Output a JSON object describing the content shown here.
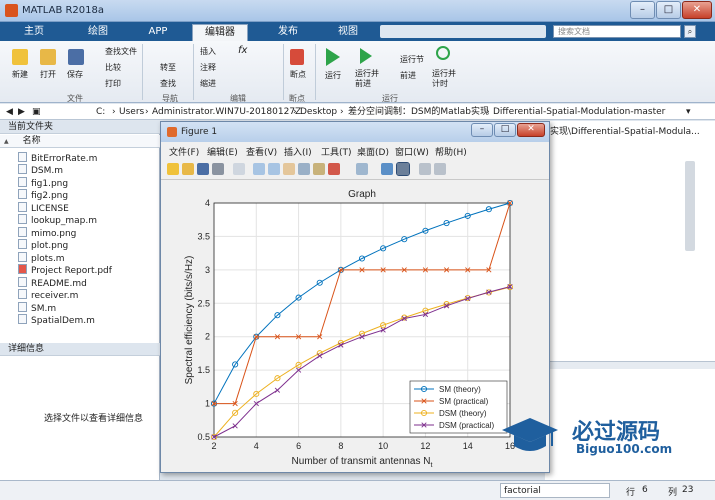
{
  "app": {
    "title": "MATLAB R2018a"
  },
  "tabs": [
    "主页",
    "绘图",
    "APP",
    "编辑器",
    "发布",
    "视图"
  ],
  "active_tab": "编辑器",
  "search": {
    "placeholder": "搜索文档"
  },
  "ribbon": {
    "new": "新建",
    "open": "打开",
    "save": "保存",
    "find_files": "查找文件",
    "compare": "比较",
    "print": "打印",
    "goto": "转至",
    "find": "查找",
    "insert": "插入",
    "comment": "注释",
    "indent": "缩进",
    "breakpoints": "断点",
    "run": "运行",
    "run_advance": "运行并\n前进",
    "run_section": "运行节",
    "advance": "前进",
    "run_time": "运行并\n计时",
    "groups": {
      "file": "文件",
      "navigate": "导航",
      "edit": "编辑",
      "breakpoints": "断点",
      "run": "运行"
    }
  },
  "address": [
    "C:",
    "Users",
    "Administrator.WIN7U-20180127Z",
    "Desktop",
    "差分空间调制：DSM的Matlab实现",
    "Differential-Spatial-Modulation-master"
  ],
  "address_tail": "实现\\Differential-Spatial-Modula...",
  "left_panel": {
    "title": "当前文件夹",
    "column": "名称",
    "sort_indicator": "▲",
    "files": [
      "BitErrorRate.m",
      "DSM.m",
      "fig1.png",
      "fig2.png",
      "LICENSE",
      "lookup_map.m",
      "mimo.png",
      "plot.png",
      "plots.m",
      "Project Report.pdf",
      "README.md",
      "receiver.m",
      "SM.m",
      "SpatialDem.m"
    ]
  },
  "details_panel": {
    "title": "详细信息",
    "message": "选择文件以查看详细信息"
  },
  "status": {
    "func": "factorial",
    "row_label": "行",
    "row": "6",
    "col_label": "列",
    "col": "23"
  },
  "figure": {
    "title": "Figure 1",
    "menu": [
      "文件(F)",
      "编辑(E)",
      "查看(V)",
      "插入(I)",
      "工具(T)",
      "桌面(D)",
      "窗口(W)",
      "帮助(H)"
    ]
  },
  "chart_data": {
    "type": "line",
    "title": "Graph",
    "xlabel": "Number of transmit antennas N",
    "xlabel_sub": "t",
    "ylabel": "Spectral efficiency (bits/s/Hz)",
    "xlim": [
      2,
      16
    ],
    "ylim": [
      0.5,
      4
    ],
    "xticks": [
      2,
      4,
      6,
      8,
      10,
      12,
      14,
      16
    ],
    "yticks": [
      0.5,
      1,
      1.5,
      2,
      2.5,
      3,
      3.5,
      4
    ],
    "ytick_labels": [
      "0.5",
      "1",
      "1.5",
      "2",
      "2.5",
      "3",
      "3.5",
      "4"
    ],
    "grid": true,
    "legend_position": "bottom-right",
    "x": [
      2,
      3,
      4,
      5,
      6,
      7,
      8,
      9,
      10,
      11,
      12,
      13,
      14,
      15,
      16
    ],
    "series": [
      {
        "name": "SM (theory)",
        "color": "#0072bd",
        "marker": "o",
        "values": [
          1.0,
          1.585,
          2.0,
          2.322,
          2.585,
          2.807,
          3.0,
          3.17,
          3.322,
          3.459,
          3.585,
          3.7,
          3.807,
          3.907,
          4.0
        ]
      },
      {
        "name": "SM (practical)",
        "color": "#d95319",
        "marker": "x",
        "values": [
          1,
          1,
          2,
          2,
          2,
          2,
          3,
          3,
          3,
          3,
          3,
          3,
          3,
          3,
          4
        ]
      },
      {
        "name": "DSM (theory)",
        "color": "#edb120",
        "marker": "o",
        "values": [
          0.5,
          0.862,
          1.145,
          1.379,
          1.579,
          1.753,
          1.908,
          2.046,
          2.172,
          2.286,
          2.39,
          2.488,
          2.578,
          2.662,
          2.742
        ]
      },
      {
        "name": "DSM (practical)",
        "color": "#7e2f8e",
        "marker": "x",
        "values": [
          0.5,
          0.667,
          1.0,
          1.2,
          1.5,
          1.714,
          1.875,
          2.0,
          2.1,
          2.273,
          2.333,
          2.462,
          2.571,
          2.667,
          2.75
        ]
      }
    ]
  },
  "watermark": {
    "brand": "必过源码",
    "site": "Biguo100.com"
  }
}
